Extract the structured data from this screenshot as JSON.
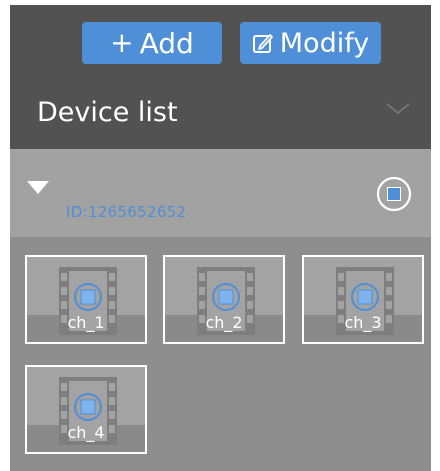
{
  "toolbar": {
    "add_label": "Add",
    "modify_label": "Modify"
  },
  "device_list": {
    "title": "Device list",
    "devices": [
      {
        "id_text": "ID:1265652652",
        "channels": [
          {
            "label": "ch_1"
          },
          {
            "label": "ch_2"
          },
          {
            "label": "ch_3"
          },
          {
            "label": "ch_4"
          }
        ]
      }
    ]
  },
  "icons": {
    "add": "plus-icon",
    "modify": "edit-icon",
    "collapse": "chevron-down-icon",
    "expand": "triangle-down-icon",
    "stop": "stop-circle-icon",
    "channel": "film-icon"
  },
  "colors": {
    "accent": "#4f8fd8",
    "panel_dark": "#525252",
    "panel_mid": "#a2a2a2",
    "panel_base": "#8e8e8e"
  }
}
